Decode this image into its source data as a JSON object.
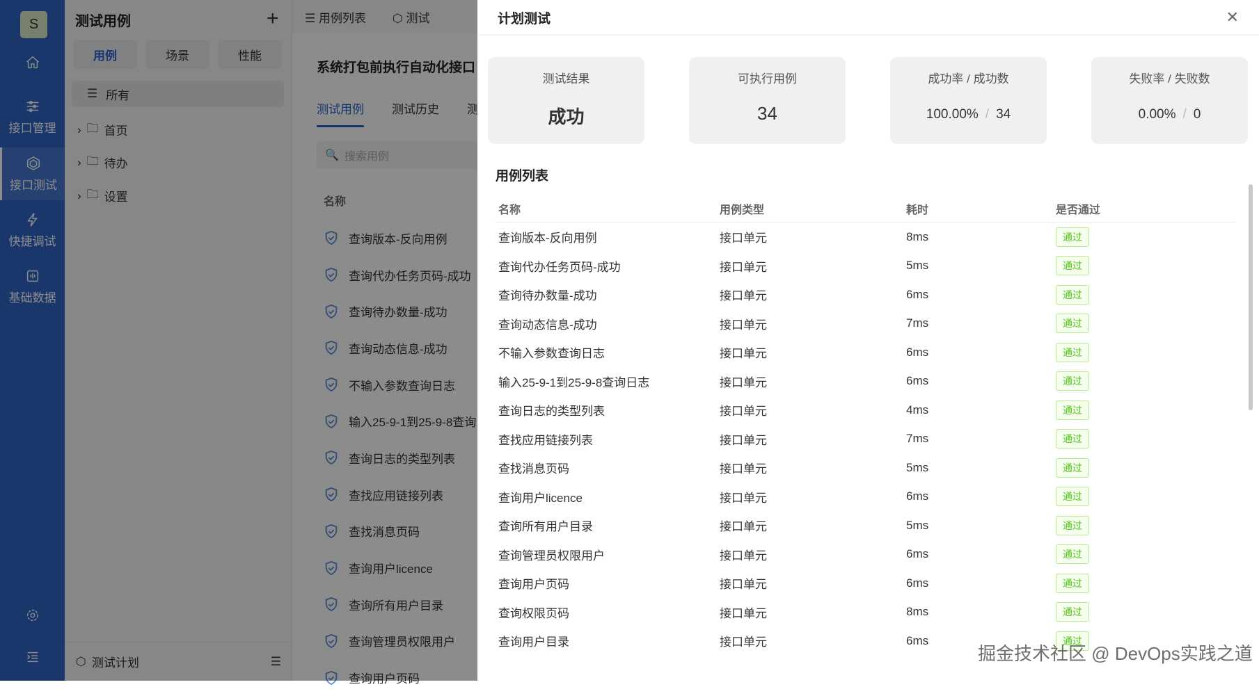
{
  "sidebar": {
    "avatar": "S",
    "items": [
      {
        "label": "接口管理"
      },
      {
        "label": "接口测试"
      },
      {
        "label": "快捷调试"
      },
      {
        "label": "基础数据"
      }
    ]
  },
  "panel": {
    "title": "测试用例",
    "segments": [
      "用例",
      "场景",
      "性能"
    ],
    "all": "所有",
    "folders": [
      "首页",
      "待办",
      "设置"
    ],
    "footer": "测试计划"
  },
  "middle": {
    "top_tabs": [
      "用例列表",
      "测试"
    ],
    "title": "系统打包前执行自动化接口",
    "tabs": [
      "测试用例",
      "测试历史",
      "测"
    ],
    "search_placeholder": "搜索用例",
    "col_name": "名称",
    "items": [
      "查询版本-反向用例",
      "查询代办任务页码-成功",
      "查询待办数量-成功",
      "查询动态信息-成功",
      "不输入参数查询日志",
      "输入25-9-1到25-9-8查询",
      "查询日志的类型列表",
      "查找应用链接列表",
      "查找消息页码",
      "查询用户licence",
      "查询所有用户目录",
      "查询管理员权限用户",
      "查询用户页码"
    ]
  },
  "drawer": {
    "title": "计划测试",
    "close": "✕",
    "cards": [
      {
        "title": "测试结果",
        "value": "成功"
      },
      {
        "title": "可执行用例",
        "value": "34"
      },
      {
        "title": "成功率 / 成功数",
        "rate": "100.00%",
        "count": "34"
      },
      {
        "title": "失败率 / 失败数",
        "rate": "0.00%",
        "count": "0"
      }
    ],
    "list_title": "用例列表",
    "headers": [
      "名称",
      "用例类型",
      "耗时",
      "是否通过"
    ],
    "rows": [
      {
        "name": "查询版本-反向用例",
        "type": "接口单元",
        "time": "8ms",
        "pass": "通过"
      },
      {
        "name": "查询代办任务页码-成功",
        "type": "接口单元",
        "time": "5ms",
        "pass": "通过"
      },
      {
        "name": "查询待办数量-成功",
        "type": "接口单元",
        "time": "6ms",
        "pass": "通过"
      },
      {
        "name": "查询动态信息-成功",
        "type": "接口单元",
        "time": "7ms",
        "pass": "通过"
      },
      {
        "name": "不输入参数查询日志",
        "type": "接口单元",
        "time": "6ms",
        "pass": "通过"
      },
      {
        "name": "输入25-9-1到25-9-8查询日志",
        "type": "接口单元",
        "time": "6ms",
        "pass": "通过"
      },
      {
        "name": "查询日志的类型列表",
        "type": "接口单元",
        "time": "4ms",
        "pass": "通过"
      },
      {
        "name": "查找应用链接列表",
        "type": "接口单元",
        "time": "7ms",
        "pass": "通过"
      },
      {
        "name": "查找消息页码",
        "type": "接口单元",
        "time": "5ms",
        "pass": "通过"
      },
      {
        "name": "查询用户licence",
        "type": "接口单元",
        "time": "6ms",
        "pass": "通过"
      },
      {
        "name": "查询所有用户目录",
        "type": "接口单元",
        "time": "5ms",
        "pass": "通过"
      },
      {
        "name": "查询管理员权限用户",
        "type": "接口单元",
        "time": "6ms",
        "pass": "通过"
      },
      {
        "name": "查询用户页码",
        "type": "接口单元",
        "time": "6ms",
        "pass": "通过"
      },
      {
        "name": "查询权限页码",
        "type": "接口单元",
        "time": "8ms",
        "pass": "通过"
      },
      {
        "name": "查询用户目录",
        "type": "接口单元",
        "time": "6ms",
        "pass": "通过"
      }
    ]
  },
  "watermark": "掘金技术社区 @ DevOps实践之道"
}
